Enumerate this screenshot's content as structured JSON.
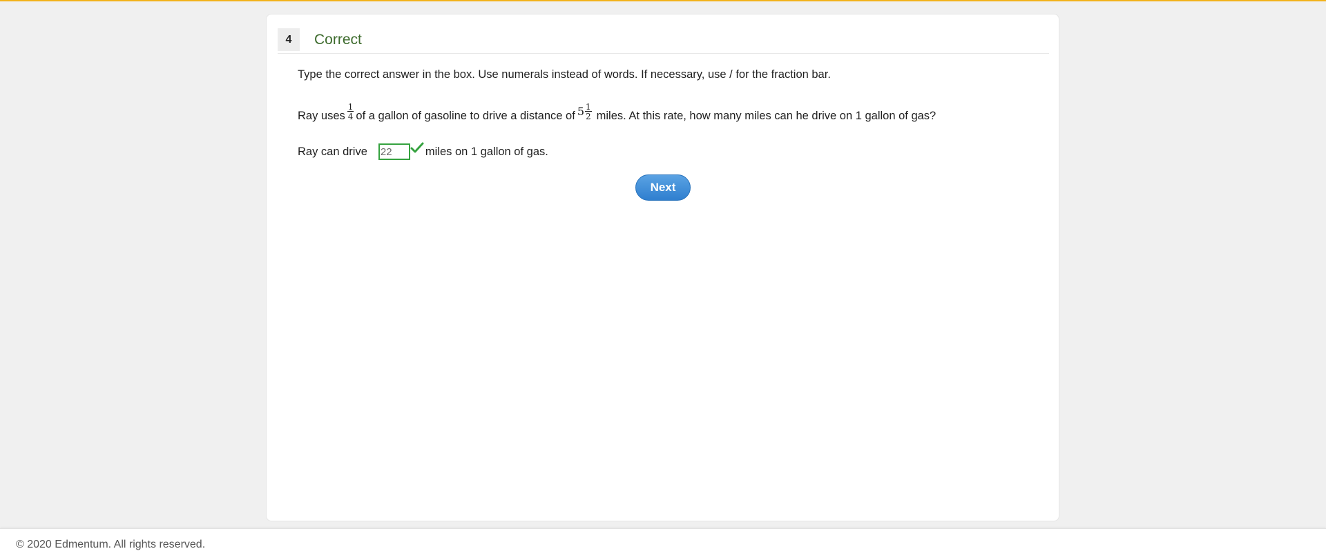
{
  "question": {
    "number": "4",
    "status": "Correct",
    "instructions": "Type the correct answer in the box. Use numerals instead of words. If necessary, use / for the fraction bar.",
    "problem": {
      "part1": "Ray uses",
      "fraction1": {
        "numerator": "1",
        "denominator": "4"
      },
      "part2": "of a gallon of gasoline to drive a distance of",
      "mixed": {
        "whole": "5",
        "numerator": "1",
        "denominator": "2"
      },
      "part3": "miles. At this rate, how many miles can he drive on 1 gallon of gas?"
    },
    "answer": {
      "before": "Ray can drive",
      "value": "22",
      "after": "miles on 1 gallon of gas."
    }
  },
  "next_label": "Next",
  "footer": {
    "copyright": "© 2020 Edmentum. All rights reserved."
  },
  "colors": {
    "accent_top": "#f2b21b",
    "correct_green": "#35a23f",
    "status_green": "#3d6b2d",
    "button_blue": "#2f7fcf"
  }
}
